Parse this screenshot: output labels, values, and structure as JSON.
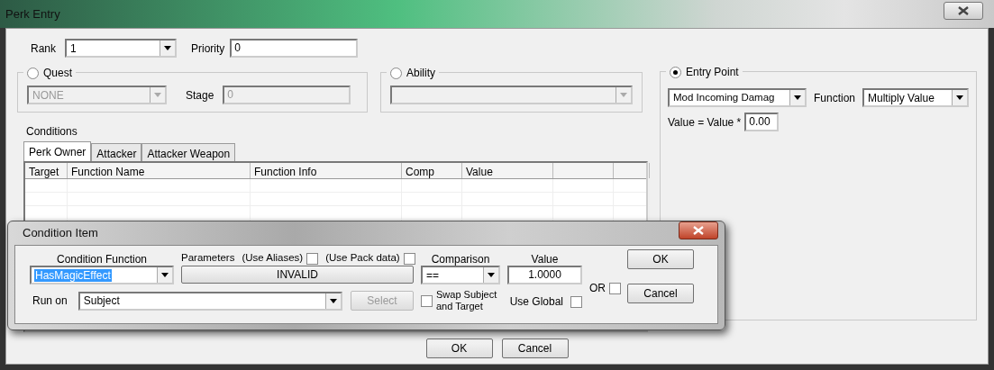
{
  "window": {
    "title": "Perk Entry"
  },
  "rank": {
    "label": "Rank",
    "value": "1"
  },
  "priority": {
    "label": "Priority",
    "value": "0"
  },
  "quest": {
    "label": "Quest",
    "selected": false,
    "value": "NONE",
    "stage_label": "Stage",
    "stage": "0",
    "disabled": true
  },
  "ability": {
    "label": "Ability",
    "selected": false,
    "disabled": true
  },
  "entry_point": {
    "label": "Entry Point",
    "selected": true,
    "point": "Mod Incoming Damag",
    "function_label": "Function",
    "function": "Multiply Value",
    "formula": "Value = Value *",
    "value": "0.00"
  },
  "conditions": {
    "label": "Conditions",
    "tabs": [
      {
        "label": "Perk Owner",
        "selected": true
      },
      {
        "label": "Attacker",
        "selected": false
      },
      {
        "label": "Attacker Weapon",
        "selected": false
      }
    ],
    "columns": [
      "Target",
      "Function Name",
      "Function Info",
      "Comp",
      "Value"
    ]
  },
  "buttons": [
    "OK",
    "Cancel"
  ],
  "condition_item": {
    "title": "Condition Item",
    "function_label": "Condition Function",
    "function": "HasMagicEffect",
    "parameters_label": "Parameters",
    "use_aliases": {
      "label": "(Use Aliases)",
      "checked": false
    },
    "use_pack_data": {
      "label": "(Use Pack data)",
      "checked": false
    },
    "parameters": "INVALID",
    "comparison_label": "Comparison",
    "comparison": "==",
    "value_label": "Value",
    "value": "1.0000",
    "or": {
      "label": "OR",
      "checked": false
    },
    "run_on_label": "Run on",
    "run_on": "Subject",
    "select": {
      "label": "Select",
      "disabled": true
    },
    "swap": {
      "label": "Swap Subject and Target",
      "checked": false
    },
    "use_global": {
      "label": "Use Global",
      "checked": false
    },
    "buttons": [
      "OK",
      "Cancel"
    ]
  }
}
